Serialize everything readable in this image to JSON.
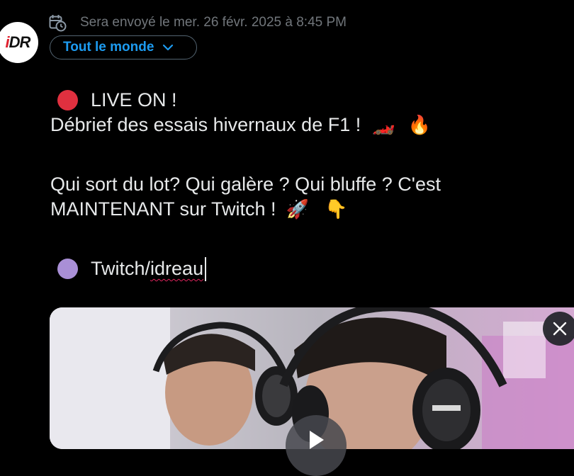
{
  "avatar": {
    "logo_prefix": "i",
    "logo_rest": "DR",
    "brand_red": "#e0202e"
  },
  "schedule": {
    "icon": "calendar-clock-icon",
    "text": "Sera envoyé le mer. 26 févr. 2025 à 8:45 PM"
  },
  "audience": {
    "label": "Tout le monde",
    "icon": "chevron-down-icon",
    "color": "#1d9bf0"
  },
  "composer": {
    "line1": {
      "emoji": "🔴",
      "text": "LIVE ON !"
    },
    "line2": {
      "text": "Débrief des essais hivernaux de F1 !",
      "emoji_1": "🏎️",
      "emoji_2": "🔥"
    },
    "line3": {
      "text": "Qui sort du lot? Qui galère ? Qui bluffe ? C'est"
    },
    "line4": {
      "text": "MAINTENANT sur Twitch !",
      "emoji_1": "🚀",
      "emoji_2": "👇"
    },
    "line5": {
      "emoji": "🟣",
      "prefix": "Twitch/",
      "misspelled": "idreau"
    }
  },
  "colors": {
    "red_dot": "#e0303f",
    "purple_dot": "#a98fd6",
    "text": "#e7e9ea",
    "muted": "#71767b"
  },
  "media": {
    "type": "video",
    "remove_icon": "close-icon",
    "play_icon": "play-icon"
  }
}
